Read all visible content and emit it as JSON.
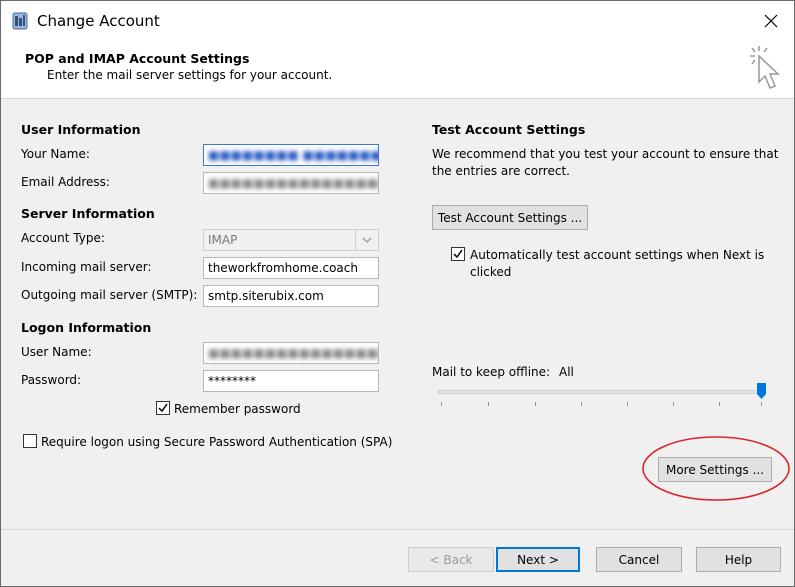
{
  "window": {
    "title": "Change Account",
    "close_label": "✕"
  },
  "header": {
    "title": "POP and IMAP Account Settings",
    "subtitle": "Enter the mail server settings for your account."
  },
  "user_info": {
    "heading": "User Information",
    "name_label": "Your Name:",
    "name_value": "■■■■■■■■ ■■■■■■■ ■■■■",
    "email_label": "Email Address:",
    "email_value": "■■■■■■■■■■■■■■■■■■■■■■"
  },
  "server_info": {
    "heading": "Server Information",
    "account_type_label": "Account Type:",
    "account_type_value": "IMAP",
    "incoming_label": "Incoming mail server:",
    "incoming_value": "theworkfromhome.coach",
    "outgoing_label": "Outgoing mail server (SMTP):",
    "outgoing_value": "smtp.siterubix.com"
  },
  "logon_info": {
    "heading": "Logon Information",
    "username_label": "User Name:",
    "username_value": "■■■■■■■■■■■■■■■■■■■■■■",
    "password_label": "Password:",
    "password_value": "********",
    "remember_label": "Remember password",
    "remember_checked": true,
    "spa_label": "Require logon using Secure Password Authentication (SPA)",
    "spa_checked": false
  },
  "test_settings": {
    "heading": "Test Account Settings",
    "description_line1": "We recommend that you test your account to ensure that",
    "description_line2": "the entries are correct.",
    "test_button": "Test Account Settings ...",
    "auto_test_line1": "Automatically test account settings when Next is",
    "auto_test_line2": "clicked",
    "auto_test_checked": true
  },
  "offline": {
    "label": "Mail to keep offline:",
    "value": "All",
    "slider_fraction": 1.0
  },
  "more_settings_button": "More Settings ...",
  "footer": {
    "back": "< Back",
    "next": "Next >",
    "cancel": "Cancel",
    "help": "Help"
  },
  "colors": {
    "accent": "#0078d7",
    "highlight_ellipse": "#d9252a"
  }
}
